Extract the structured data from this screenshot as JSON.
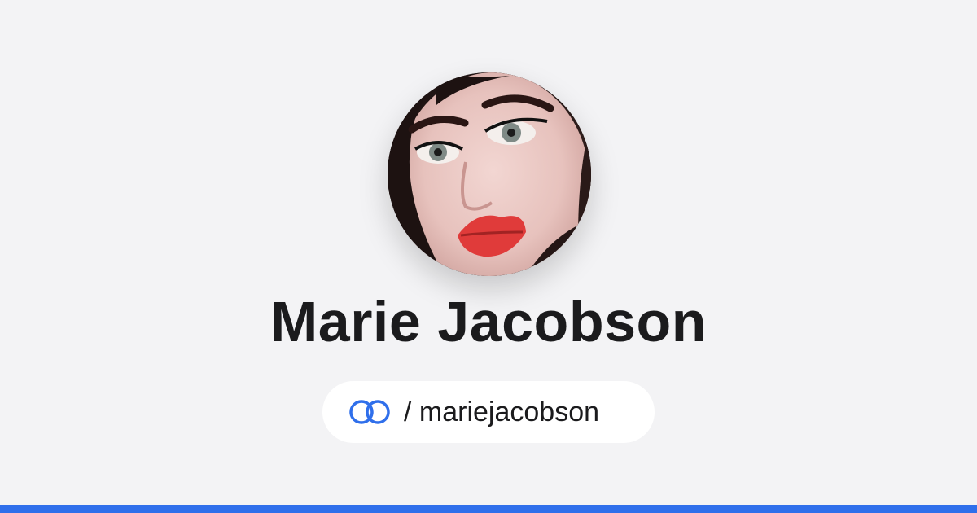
{
  "profile": {
    "name": "Marie Jacobson",
    "handle": "/ mariejacobson",
    "avatar_icon": "profile-photo",
    "logo_icon": "linked-rings-icon"
  },
  "colors": {
    "background": "#f3f3f5",
    "accent": "#2f6feb",
    "text": "#1b1b1d",
    "pill": "#ffffff"
  }
}
